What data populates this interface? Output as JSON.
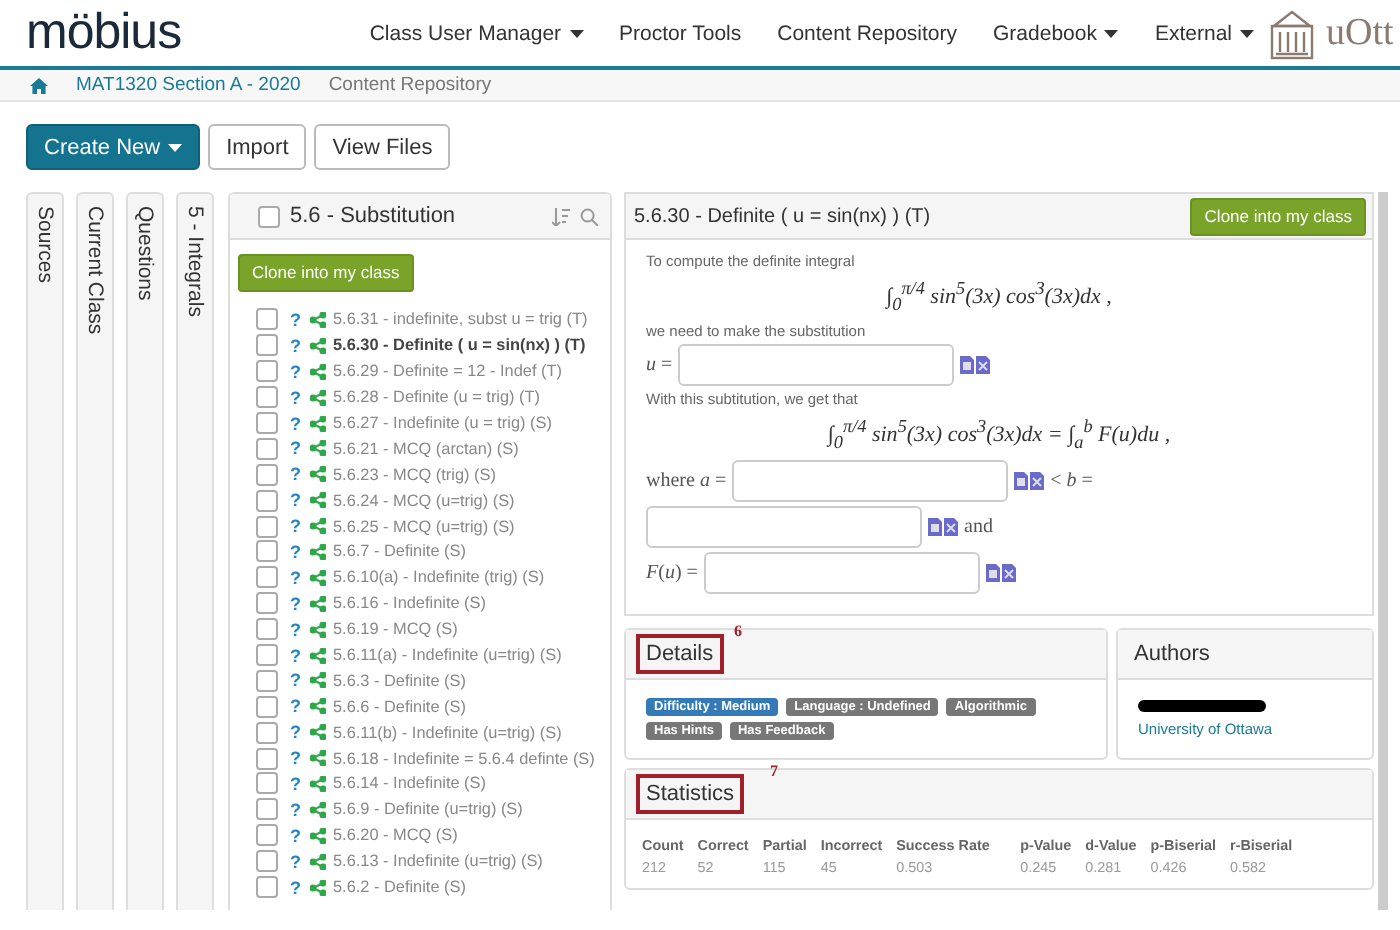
{
  "header": {
    "logo": "möbius",
    "nav": [
      {
        "label": "Class User Manager",
        "dropdown": true
      },
      {
        "label": "Proctor Tools",
        "dropdown": false
      },
      {
        "label": "Content Repository",
        "dropdown": false
      },
      {
        "label": "Gradebook",
        "dropdown": true
      },
      {
        "label": "External",
        "dropdown": true
      }
    ],
    "brand_text": "uOtt"
  },
  "breadcrumb": [
    {
      "label": "MAT1320 Section A - 2020",
      "link": true
    },
    {
      "label": "Content Repository",
      "link": false
    }
  ],
  "toolbar": [
    {
      "label": "Create New",
      "kind": "primary"
    },
    {
      "label": "Import",
      "kind": "default"
    },
    {
      "label": "View Files",
      "kind": "default"
    }
  ],
  "side_tabs": [
    {
      "label": "Sources"
    },
    {
      "label": "Current Class"
    },
    {
      "label": "Questions"
    },
    {
      "label": "5 - Integrals"
    }
  ],
  "folder": {
    "title": "5.6 - Substitution",
    "checked": false,
    "clone_button": "Clone into my class",
    "items": [
      {
        "help": "?",
        "label": "5.6.31 - indefinite, subst u = trig (T)",
        "selected": false,
        "checked": false
      },
      {
        "help": "?",
        "label": "5.6.30 - Definite ( u = sin(nx) ) (T)",
        "selected": true,
        "checked": false
      },
      {
        "help": "?",
        "label": "5.6.29 - Definite = 12 - Indef (T)",
        "selected": false,
        "checked": false
      },
      {
        "help": "?",
        "label": "5.6.28 - Definite (u = trig) (T)",
        "selected": false,
        "checked": false
      },
      {
        "help": "?",
        "label": "5.6.27 - Indefinite (u = trig) (S)",
        "selected": false,
        "checked": false
      },
      {
        "help": "?",
        "label": "5.6.21 - MCQ (arctan) (S)",
        "selected": false,
        "checked": false
      },
      {
        "help": "?",
        "label": "5.6.23 - MCQ (trig) (S)",
        "selected": false,
        "checked": false
      },
      {
        "help": "?",
        "label": "5.6.24 - MCQ (u=trig) (S)",
        "selected": false,
        "checked": false
      },
      {
        "help": "?",
        "label": "5.6.25 - MCQ (u=trig) (S)",
        "selected": false,
        "checked": false
      },
      {
        "help": "?",
        "label": "5.6.7 - Definite (S)",
        "selected": false,
        "checked": false
      },
      {
        "help": "?",
        "label": "5.6.10(a) - Indefinite (trig) (S)",
        "selected": false,
        "checked": false
      },
      {
        "help": "?",
        "label": "5.6.16 - Indefinite (S)",
        "selected": false,
        "checked": false
      },
      {
        "help": "?",
        "label": "5.6.19 - MCQ (S)",
        "selected": false,
        "checked": false
      },
      {
        "help": "?",
        "label": "5.6.11(a) - Indefinite (u=trig) (S)",
        "selected": false,
        "checked": false
      },
      {
        "help": "?",
        "label": "5.6.3 - Definite (S)",
        "selected": false,
        "checked": false
      },
      {
        "help": "?",
        "label": "5.6.6 - Definite (S)",
        "selected": false,
        "checked": false
      },
      {
        "help": "?",
        "label": "5.6.11(b) - Indefinite (u=trig) (S)",
        "selected": false,
        "checked": false
      },
      {
        "help": "?",
        "label": "5.6.18 - Indefinite = 5.6.4 definte (S)",
        "selected": false,
        "checked": false
      },
      {
        "help": "?",
        "label": "5.6.14 - Indefinite (S)",
        "selected": false,
        "checked": false
      },
      {
        "help": "?",
        "label": "5.6.9 - Definite (u=trig) (S)",
        "selected": false,
        "checked": false
      },
      {
        "help": "?",
        "label": "5.6.20 - MCQ (S)",
        "selected": false,
        "checked": false
      },
      {
        "help": "?",
        "label": "5.6.13 - Indefinite (u=trig) (S)",
        "selected": false,
        "checked": false
      },
      {
        "help": "?",
        "label": "5.6.2 - Definite (S)",
        "selected": false,
        "checked": false
      }
    ]
  },
  "preview": {
    "title": "5.6.30 - Definite ( u = sin(nx) ) (T)",
    "clone_button": "Clone into my class",
    "blocks": [
      {
        "kind": "text",
        "text": "To compute the definite integral"
      },
      {
        "kind": "math",
        "text": "∫$_{0}$$^{π/4}$ sin$^{5}$(3x) cos$^{3}$(3x)dx ,"
      },
      {
        "kind": "text",
        "text": "we need to make the substitution"
      },
      {
        "kind": "field",
        "label": "*u* ="
      },
      {
        "kind": "text",
        "text": "With this subtitution, we get that"
      },
      {
        "kind": "math",
        "text": "∫$_{0}$$^{π/4}$ sin$^{5}$(3x) cos$^{3}$(3x)dx = ∫$_{a}$$^{b}$ F(u)du ,"
      },
      {
        "kind": "field",
        "label": "where *a* =",
        "after": "< *b* ="
      },
      {
        "kind": "field",
        "after": "and"
      },
      {
        "kind": "field",
        "label": "*F*(*u*) ="
      }
    ]
  },
  "details": {
    "title": "Details",
    "marker": "6",
    "badges": [
      {
        "text": "Difficulty : Medium",
        "color": "#337ab7"
      },
      {
        "text": "Language : Undefined",
        "color": "#777777"
      },
      {
        "text": "Algorithmic",
        "color": "#777777"
      },
      {
        "text": "Has Hints",
        "color": "#777777"
      },
      {
        "text": "Has Feedback",
        "color": "#777777"
      }
    ]
  },
  "authors": {
    "title": "Authors",
    "affiliation": "University of Ottawa"
  },
  "statistics": {
    "title": "Statistics",
    "marker": "7",
    "columns": [
      {
        "heading": "Count",
        "value": "212"
      },
      {
        "heading": "Correct",
        "value": "52"
      },
      {
        "heading": "Partial",
        "value": "115"
      },
      {
        "heading": "Incorrect",
        "value": "45"
      },
      {
        "heading": "Success Rate",
        "value": "0.503"
      },
      {
        "heading": "p-Value",
        "value": "0.245"
      },
      {
        "heading": "d-Value",
        "value": "0.281"
      },
      {
        "heading": "p-Biserial",
        "value": "0.426"
      },
      {
        "heading": "r-Biserial",
        "value": "0.582"
      }
    ]
  }
}
